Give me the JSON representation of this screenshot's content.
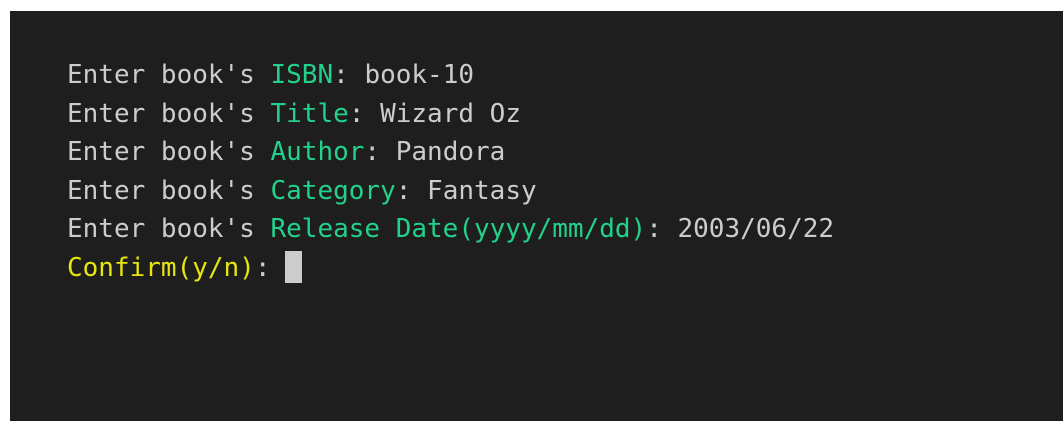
{
  "terminal": {
    "lines": [
      {
        "prefix": "Enter book's ",
        "field": "ISBN",
        "sep": ": ",
        "value": "book-10"
      },
      {
        "prefix": "Enter book's ",
        "field": "Title",
        "sep": ": ",
        "value": "Wizard Oz"
      },
      {
        "prefix": "Enter book's ",
        "field": "Author",
        "sep": ": ",
        "value": "Pandora"
      },
      {
        "prefix": "Enter book's ",
        "field": "Category",
        "sep": ": ",
        "value": "Fantasy"
      },
      {
        "prefix": "Enter book's ",
        "field": "Release Date(yyyy/mm/dd)",
        "sep": ": ",
        "value": "2003/06/22"
      }
    ],
    "confirm": {
      "label": "Confirm(y/n)",
      "sep": ":",
      "value": ""
    }
  },
  "colors": {
    "background": "#1e1e1e",
    "text": "#cccccc",
    "field": "#23d18b",
    "confirm": "#e5e510"
  }
}
